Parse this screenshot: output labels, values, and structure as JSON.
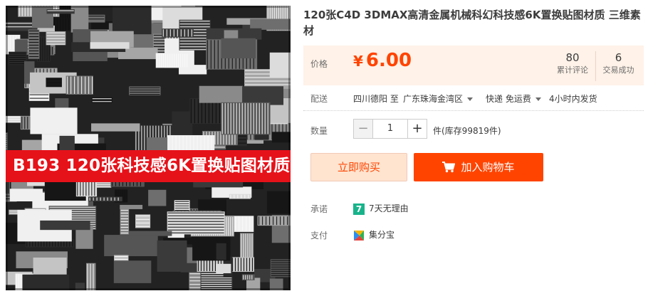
{
  "image": {
    "banner_text": "B193 120张科技感6K置换贴图材质",
    "colors": {
      "banner_bg": "#e6121a",
      "banner_text": "#ffffff"
    }
  },
  "product": {
    "title": "120张C4D 3DMAX高清金属机械科幻科技感6K置换贴图材质 三维素材"
  },
  "price": {
    "label": "价格",
    "currency": "¥",
    "value": "6.00",
    "color": "#ff4400"
  },
  "stats": {
    "reviews_count": "80",
    "reviews_label": "累计评论",
    "trades_count": "6",
    "trades_label": "交易成功"
  },
  "delivery": {
    "label": "配送",
    "from": "四川德阳 至",
    "to": "广东珠海金湾区",
    "method": "快递 免运费",
    "ship_time": "4小时内发货"
  },
  "quantity": {
    "label": "数量",
    "value": "1",
    "minus": "−",
    "plus": "+",
    "stock": "件(库存99819件)"
  },
  "actions": {
    "buy_now": "立即购买",
    "add_to_cart": "加入购物车",
    "colors": {
      "primary": "#ff4400",
      "secondary_bg": "#ffe4d0"
    }
  },
  "promise": {
    "label": "承诺",
    "badge": "7",
    "text": "7天无理由",
    "icon": "seven-day-return-icon"
  },
  "payment": {
    "label": "支付",
    "text": "集分宝",
    "icon": "jifenbao-icon"
  }
}
